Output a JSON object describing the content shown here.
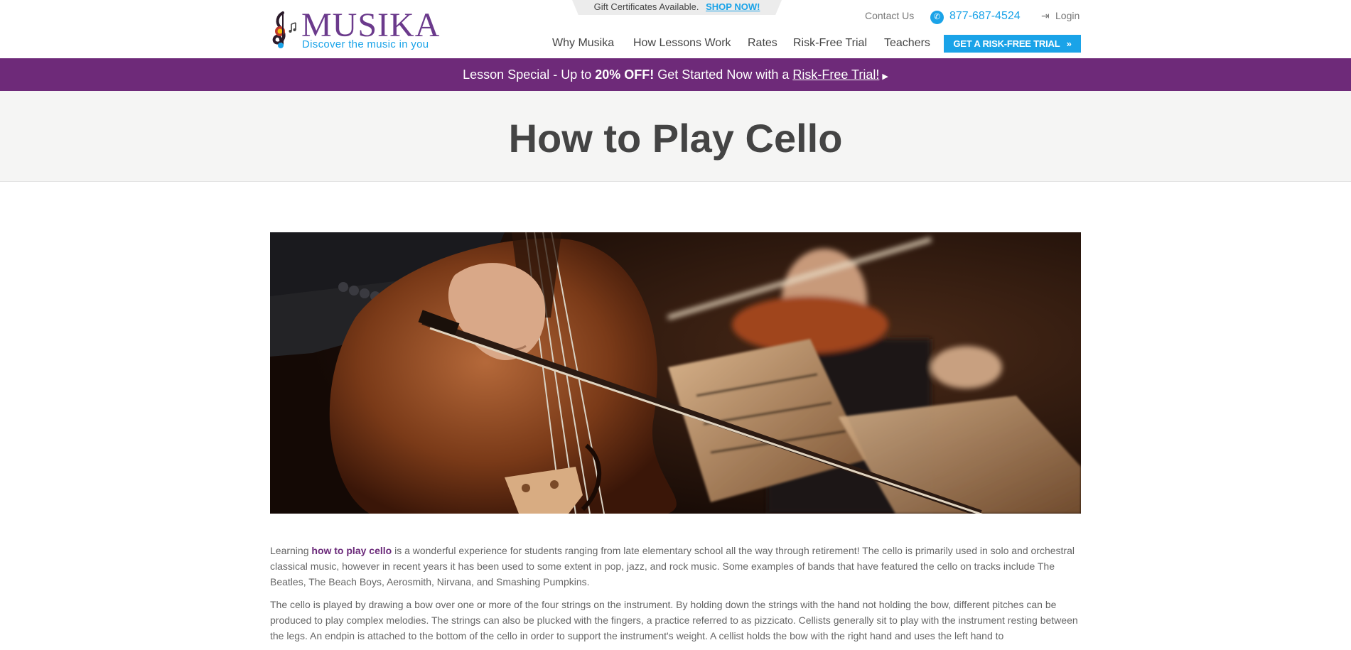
{
  "gift_banner": {
    "text": "Gift Certificates Available.",
    "link": "SHOP NOW!"
  },
  "brand": {
    "name": "MUSIKA",
    "tagline": "Discover the music in you",
    "purple": "#6b3a8c",
    "blue": "#1aa3e8"
  },
  "top_links": {
    "contact": "Contact Us",
    "phone": "877-687-4524",
    "login": "Login"
  },
  "nav": {
    "items": [
      "Why Musika",
      "How Lessons Work",
      "Rates",
      "Risk-Free Trial",
      "Teachers"
    ],
    "cta": "GET A RISK-FREE TRIAL"
  },
  "promo": {
    "prefix": "Lesson Special - Up to ",
    "highlight": "20% OFF!",
    "middle": " Get Started Now with a ",
    "link": "Risk-Free Trial!",
    "color": "#6e2a79"
  },
  "page": {
    "title": "How to Play Cello"
  },
  "article": {
    "p1_before": "Learning ",
    "p1_highlight": "how to play cello",
    "p1_after": " is a wonderful experience for students ranging from late elementary school all the way through retirement! The cello is primarily used in solo and orchestral classical music, however in recent years it has been used to some extent in pop, jazz, and rock music. Some examples of bands that have featured the cello on tracks include The Beatles, The Beach Boys, Aerosmith, Nirvana, and Smashing Pumpkins.",
    "p2": "The cello is played by drawing a bow over one or more of the four strings on the instrument. By holding down the strings with the hand not holding the bow, different pitches can be produced to play complex melodies. The strings can also be plucked with the fingers, a practice referred to as pizzicato. Cellists generally sit to play with the instrument resting between the legs. An endpin is attached to the bottom of the cello in order to support the instrument's weight. A cellist holds the bow with the right hand and uses the left hand to"
  }
}
